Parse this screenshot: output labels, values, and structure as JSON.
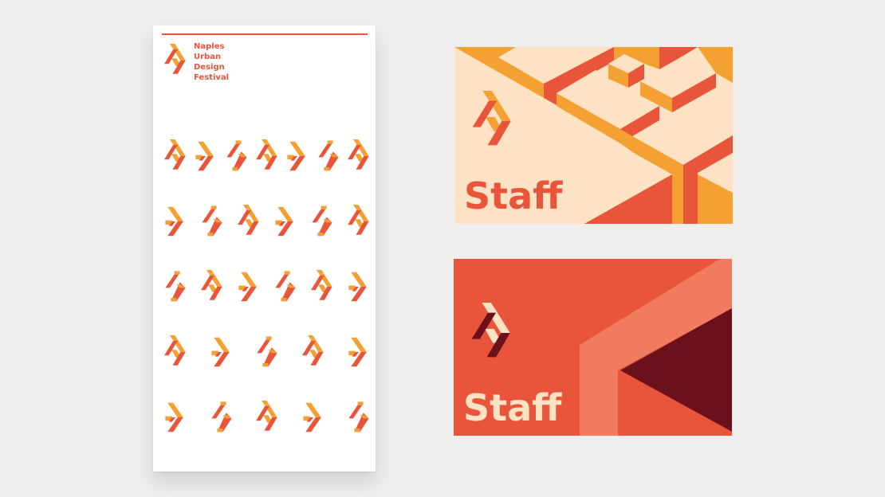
{
  "poster": {
    "title_lines": [
      "Naples",
      "Urban",
      "Design",
      "Festival"
    ],
    "glyph_rows": [
      7,
      6,
      6,
      5,
      5
    ]
  },
  "cards": [
    {
      "label": "Staff",
      "theme": "light"
    },
    {
      "label": "Staff",
      "theme": "dark"
    }
  ],
  "colors": {
    "background": "#efeeec",
    "red": "#e8553a",
    "orange": "#f4a033",
    "cream": "#fde3c3",
    "salmon": "#f07b5f",
    "maroon": "#6b111c"
  }
}
